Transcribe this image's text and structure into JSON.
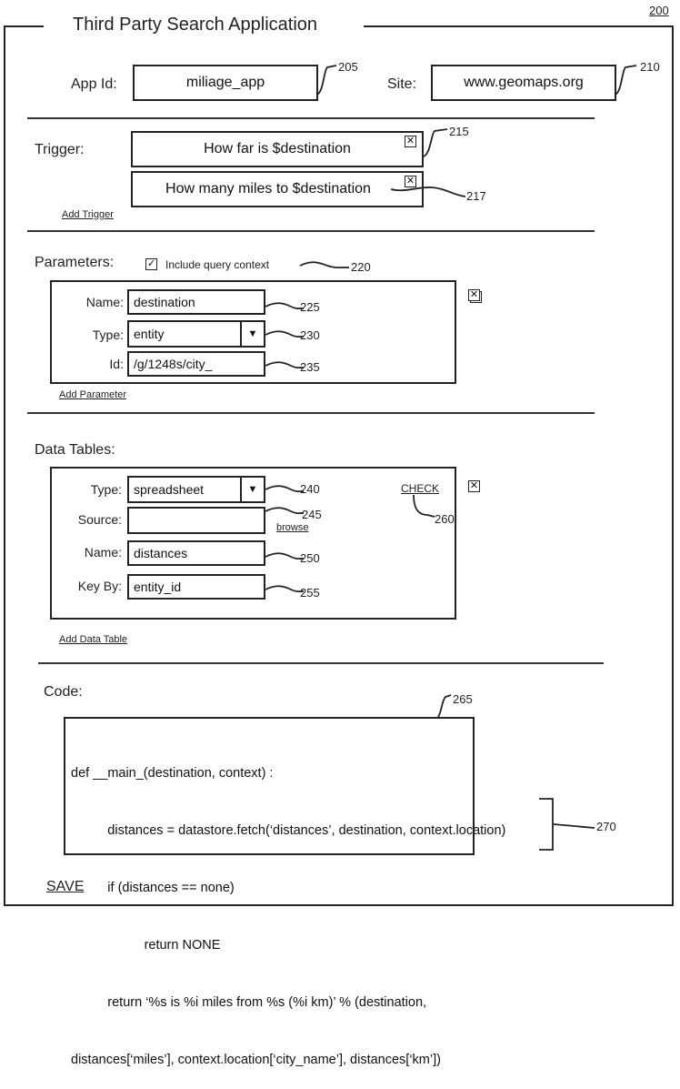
{
  "figure_number": "200",
  "app": {
    "title": "Third Party Search Application",
    "app_id": {
      "label": "App Id:",
      "value": "miliage_app",
      "ref": "205"
    },
    "site": {
      "label": "Site:",
      "value": "www.geomaps.org",
      "ref": "210"
    }
  },
  "trigger": {
    "label": "Trigger:",
    "items": [
      {
        "value": "How far is $destination",
        "ref": "215",
        "remove_icon": "close-box-icon"
      },
      {
        "value": "How many miles to $destination",
        "ref": "217",
        "remove_icon": "close-box-icon"
      }
    ],
    "add_link": "Add Trigger"
  },
  "parameters": {
    "label": "Parameters:",
    "include_query_context": {
      "label": "Include query context",
      "checked": true,
      "ref": "220"
    },
    "fields": {
      "name": {
        "label": "Name:",
        "value": "destination",
        "ref": "225"
      },
      "type": {
        "label": "Type:",
        "value": "entity",
        "ref": "230"
      },
      "id": {
        "label": "Id:",
        "value": "/g/1248s/city_",
        "ref": "235"
      }
    },
    "add_link": "Add Parameter"
  },
  "data_tables": {
    "label": "Data Tables:",
    "fields": {
      "type": {
        "label": "Type:",
        "value": "spreadsheet",
        "ref": "240"
      },
      "source": {
        "label": "Source:",
        "value": "",
        "ref": "245",
        "browse": "browse"
      },
      "name": {
        "label": "Name:",
        "value": "distances",
        "ref": "250"
      },
      "key_by": {
        "label": "Key By:",
        "value": "entity_id",
        "ref": "255"
      }
    },
    "check": {
      "label": "CHECK",
      "ref": "260"
    },
    "add_link": "Add Data Table"
  },
  "code": {
    "label": "Code:",
    "ref": "265",
    "return_ref": "270",
    "lines": [
      "def __main_(destination, context) :",
      "          distances = datastore.fetch(‘distances’, destination, context.location)",
      "          if (distances == none)",
      "                    return NONE",
      "          return ‘%s is %i miles from %s (%i km)’ % (destination,",
      "distances[‘miles’], context.location[‘city_name’], distances[‘km’])"
    ]
  },
  "save_label": "SAVE"
}
